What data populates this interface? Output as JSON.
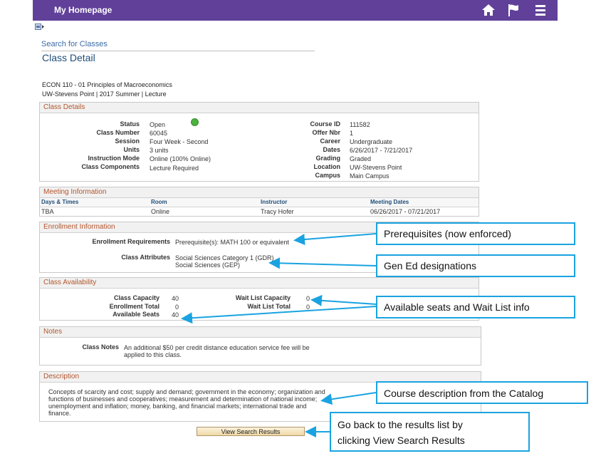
{
  "header": {
    "title": "My Homepage"
  },
  "breadcrumb": "Search for Classes",
  "page_title": "Class Detail",
  "course": {
    "line1": "ECON  110 - 01   Principles of Macroeconomics",
    "line2": "UW-Stevens Point | 2017 Summer | Lecture"
  },
  "class_details": {
    "heading": "Class Details",
    "left": [
      {
        "label": "Status",
        "value": "Open"
      },
      {
        "label": "Class Number",
        "value": "60045"
      },
      {
        "label": "Session",
        "value": "Four Week - Second"
      },
      {
        "label": "Units",
        "value": "3 units"
      },
      {
        "label": "Instruction Mode",
        "value": "Online (100% Online)"
      },
      {
        "label": "Class Components",
        "value": "Lecture Required"
      }
    ],
    "right": [
      {
        "label": "Course ID",
        "value": "111582"
      },
      {
        "label": "Offer Nbr",
        "value": "1"
      },
      {
        "label": "Career",
        "value": "Undergraduate"
      },
      {
        "label": "Dates",
        "value": "6/26/2017 - 7/21/2017"
      },
      {
        "label": "Grading",
        "value": "Graded"
      },
      {
        "label": "Location",
        "value": "UW-Stevens Point"
      },
      {
        "label": "Campus",
        "value": "Main Campus"
      }
    ]
  },
  "meeting": {
    "heading": "Meeting Information",
    "columns": [
      "Days & Times",
      "Room",
      "Instructor",
      "Meeting Dates"
    ],
    "row": [
      "TBA",
      "Online",
      "Tracy Hofer",
      "06/26/2017 - 07/21/2017"
    ]
  },
  "enrollment": {
    "heading": "Enrollment Information",
    "req_label": "Enrollment Requirements",
    "req_value": "Prerequisite(s): MATH 100 or equivalent",
    "attr_label": "Class Attributes",
    "attr_value1": "Social Sciences Category 1 (GDR)",
    "attr_value2": "Social Sciences (GEP)"
  },
  "availability": {
    "heading": "Class Availability",
    "capacity_label": "Class Capacity",
    "capacity": "40",
    "enrolled_label": "Enrollment Total",
    "enrolled": "0",
    "available_label": "Available Seats",
    "available": "40",
    "wl_capacity_label": "Wait List Capacity",
    "wl_capacity": "0",
    "wl_total_label": "Wait List Total",
    "wl_total": "0"
  },
  "notes": {
    "heading": "Notes",
    "label": "Class Notes",
    "line1": "An additional $50 per credit distance education service fee will be",
    "line2": "applied to this class."
  },
  "description": {
    "heading": "Description",
    "lines": [
      "Concepts of scarcity and cost; supply and demand; government in the economy; organization and",
      "functions of businesses and cooperatives; measurement and determination of national income;",
      "unemployment and inflation; money, banking, and financial markets; international trade and",
      "finance."
    ]
  },
  "view_button": "View Search Results",
  "callouts": {
    "prereq": "Prerequisites (now enforced)",
    "gened": "Gen Ed designations",
    "seats": "Available seats and Wait List info",
    "desc": "Course description from the Catalog",
    "back_line1": "Go back to the results list by",
    "back_line2": "clicking View Search Results"
  },
  "colors": {
    "header": "#61409a",
    "section_title": "#b4552c",
    "callout_border": "#1aa3e0",
    "status_open": "#4ab23d"
  }
}
